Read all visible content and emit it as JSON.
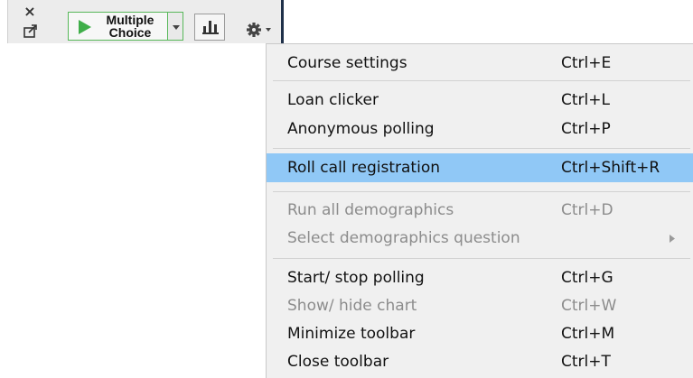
{
  "toolbar": {
    "close_glyph": "×",
    "primary_button_label": "Multiple\nChoice",
    "accent_color": "#4cb050"
  },
  "menu": {
    "items": [
      {
        "label": "Course settings",
        "shortcut": "Ctrl+E",
        "enabled": true
      },
      {
        "label": "Loan clicker",
        "shortcut": "Ctrl+L",
        "enabled": true
      },
      {
        "label": "Anonymous polling",
        "shortcut": "Ctrl+P",
        "enabled": true
      },
      {
        "label": "Roll call registration",
        "shortcut": "Ctrl+Shift+R",
        "enabled": true,
        "highlighted": true
      },
      {
        "label": "Run all demographics",
        "shortcut": "Ctrl+D",
        "enabled": false
      },
      {
        "label": "Select demographics question",
        "shortcut": "",
        "enabled": false,
        "has_submenu": true
      },
      {
        "label": "Start/ stop polling",
        "shortcut": "Ctrl+G",
        "enabled": true
      },
      {
        "label": "Show/ hide chart",
        "shortcut": "Ctrl+W",
        "enabled": false
      },
      {
        "label": "Minimize toolbar",
        "shortcut": "Ctrl+M",
        "enabled": true
      },
      {
        "label": "Close toolbar",
        "shortcut": "Ctrl+T",
        "enabled": true
      }
    ],
    "highlight_color": "#90c8f6"
  }
}
